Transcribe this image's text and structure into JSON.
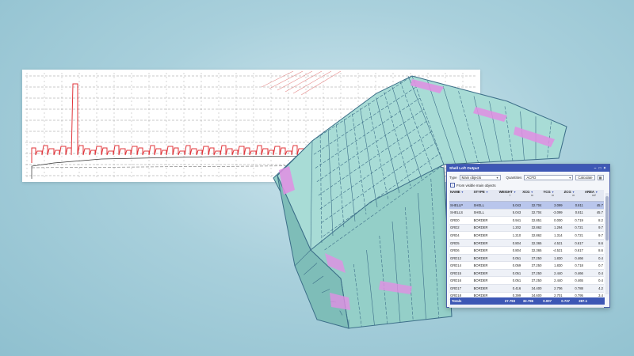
{
  "window": {
    "title": "Shell Loft Output",
    "buttons": [
      "–",
      "□",
      "×"
    ]
  },
  "filters": {
    "type_label": "Type",
    "type_value": "Main objects",
    "quantities_label": "Quantities",
    "quantities_value": "ACFD",
    "calculate_label": "Calculate",
    "checkbox_label": "From visible main objects",
    "checkbox_checked": true
  },
  "table": {
    "columns": [
      {
        "label": "NAME",
        "unit": ""
      },
      {
        "label": "STYPE",
        "unit": ""
      },
      {
        "label": "WEIGHT",
        "unit": "t"
      },
      {
        "label": "XCG",
        "unit": "m"
      },
      {
        "label": "YCG",
        "unit": "m"
      },
      {
        "label": "ZCG",
        "unit": "m"
      },
      {
        "label": "AREA",
        "unit": "m2"
      }
    ],
    "rows": [
      [
        "SHELLP",
        "SHELL",
        "5.043",
        "32.704",
        "3.099",
        "0.811",
        "45.7"
      ],
      [
        "SHELLS",
        "SHELL",
        "5.043",
        "32.704",
        "-3.099",
        "0.811",
        "45.7"
      ],
      [
        "GRD0",
        "BORDER",
        "0.941",
        "32.851",
        "0.000",
        "0.719",
        "8.2"
      ],
      [
        "GRD2",
        "BORDER",
        "1.202",
        "32.862",
        "1.294",
        "0.721",
        "9.7"
      ],
      [
        "GRD4",
        "BORDER",
        "1.210",
        "32.862",
        "1.314",
        "0.721",
        "9.7"
      ],
      [
        "GRD5",
        "BORDER",
        "0.804",
        "32.365",
        "4.521",
        "0.617",
        "8.6"
      ],
      [
        "GRD6",
        "BORDER",
        "0.804",
        "32.365",
        "-4.521",
        "0.617",
        "8.6"
      ],
      [
        "GRD12",
        "BORDER",
        "0.051",
        "37.250",
        "1.830",
        "0.466",
        "0.4"
      ],
      [
        "GRD14",
        "BORDER",
        "0.059",
        "37.250",
        "1.830",
        "0.718",
        "0.7"
      ],
      [
        "GRD15",
        "BORDER",
        "0.051",
        "37.250",
        "2.440",
        "0.466",
        "0.4"
      ],
      [
        "GRD16",
        "BORDER",
        "0.051",
        "37.250",
        "2.440",
        "0.465",
        "0.4"
      ],
      [
        "GRD17",
        "BORDER",
        "0.416",
        "34.400",
        "2.706",
        "0.788",
        "4.2"
      ],
      [
        "GRD18",
        "BORDER",
        "0.399",
        "34.600",
        "2.701",
        "0.795",
        "3.4"
      ],
      [
        "GRD19",
        "BORDER",
        "0.229",
        "34.600",
        "3.470",
        "0.809",
        "3.4"
      ]
    ],
    "selected_row": 0,
    "totals": {
      "label": "Totals",
      "weight": "27.793",
      "xcg": "32.796",
      "ycg": "0.007",
      "zcg": "0.737",
      "area": "287.1"
    }
  },
  "colors": {
    "accent": "#3d57b5",
    "drawing_red": "#e0343a",
    "hull_fill": "#a8dcd6",
    "hull_edge": "#3c6e88",
    "highlight_pink": "#e18ee3"
  },
  "icons": {
    "filter": "filter-icon",
    "dropdown": "chevron-down-icon",
    "export": "excel-export-icon"
  }
}
